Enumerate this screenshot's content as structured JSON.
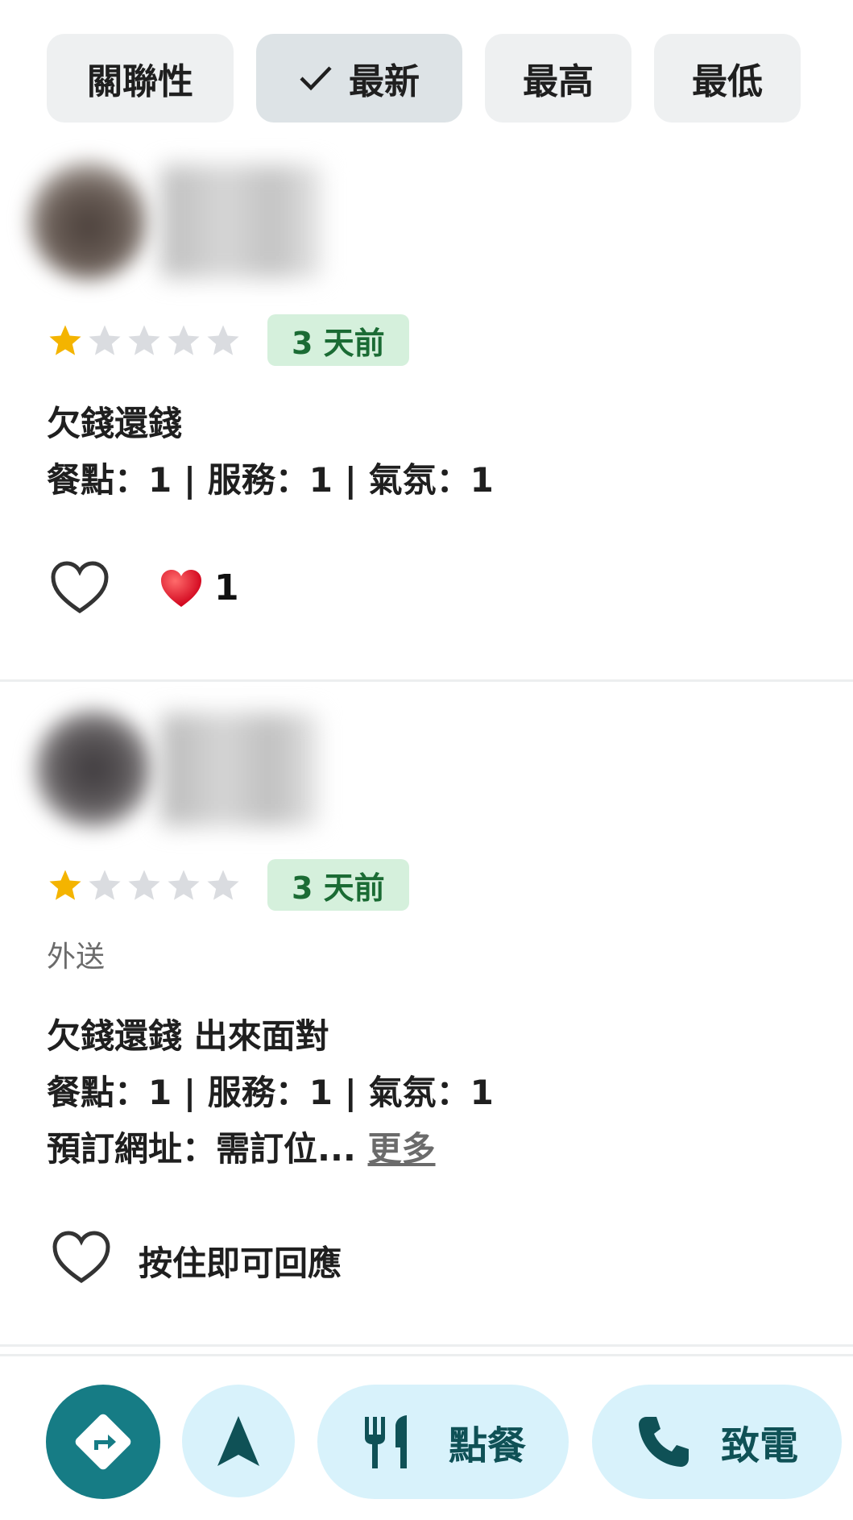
{
  "sort_chips": [
    {
      "label": "關聯性",
      "selected": false
    },
    {
      "label": "最新",
      "selected": true
    },
    {
      "label": "最高",
      "selected": false
    },
    {
      "label": "最低",
      "selected": false
    }
  ],
  "reviews": [
    {
      "rating": 1,
      "rating_max": 5,
      "time_badge": "3 天前",
      "text_line1": "欠錢還錢",
      "text_line2": "餐點：1 | 服務：1 | 氣氛：1",
      "reaction_count": "1"
    },
    {
      "rating": 1,
      "rating_max": 5,
      "time_badge": "3 天前",
      "service_tag": "外送",
      "text_line1": "欠錢還錢 出來面對",
      "text_line2": "餐點：1 | 服務：1 | 氣氛：1",
      "text_line3": "預訂網址：需訂位...",
      "more_label": "更多",
      "reaction_hint": "按住即可回應"
    }
  ],
  "bottom_bar": {
    "order_label": "點餐",
    "call_label": "致電"
  },
  "colors": {
    "accent_dark": "#167c85",
    "accent_light": "#d8f2fb",
    "star_filled": "#f4b400",
    "star_empty": "#dadce0",
    "badge_bg": "#d5f0dc",
    "badge_text": "#1b6b34"
  },
  "icons": [
    "check-icon",
    "star-icon",
    "heart-outline-icon",
    "red-heart-icon",
    "directions-icon",
    "navigate-icon",
    "fork-knife-icon",
    "phone-icon"
  ]
}
